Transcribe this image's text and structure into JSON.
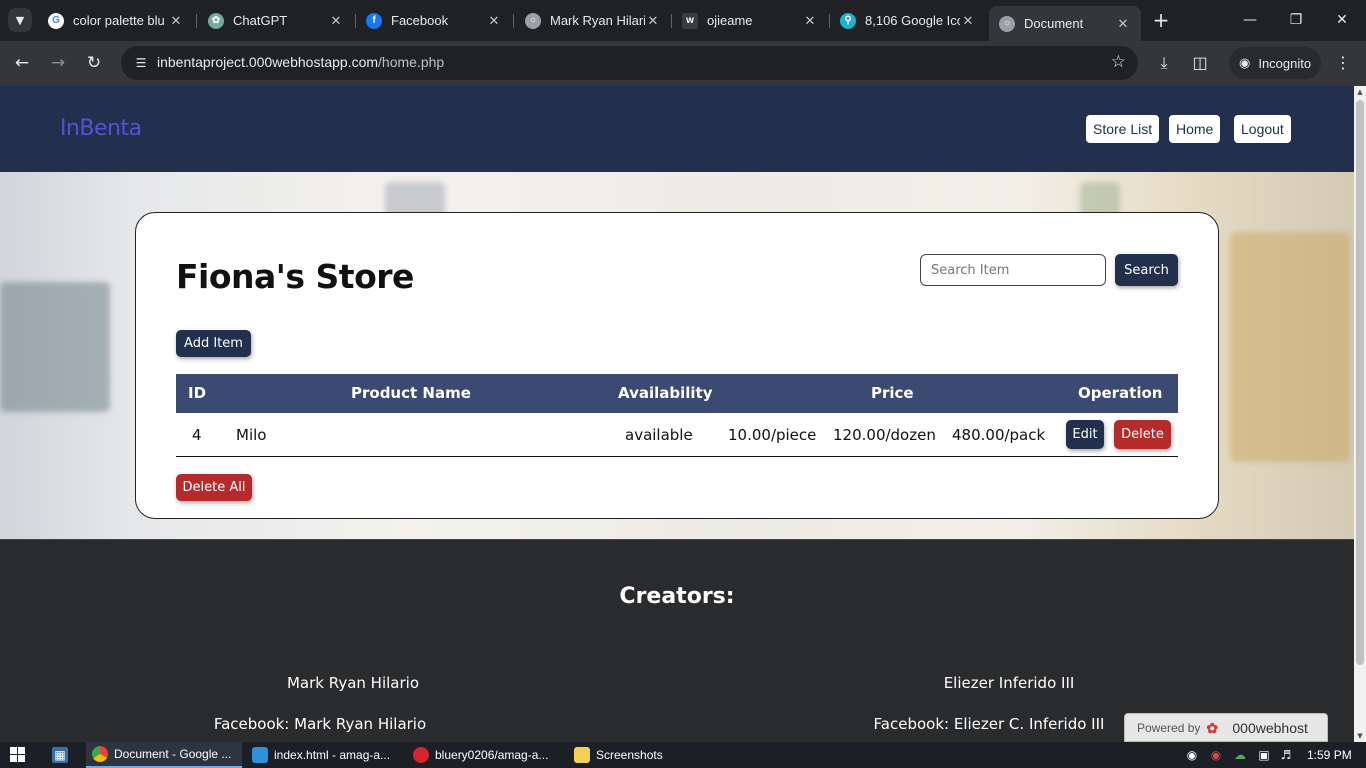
{
  "browser": {
    "tabs": [
      {
        "title": "color palette blu",
        "favicon": "google-icon",
        "color": "#ffffff"
      },
      {
        "title": "ChatGPT",
        "favicon": "chatgpt-icon",
        "color": "#74aa9c"
      },
      {
        "title": "Facebook",
        "favicon": "facebook-icon",
        "color": "#1877f2"
      },
      {
        "title": "Mark Ryan Hilari",
        "favicon": "globe-icon",
        "color": "#9aa0a6"
      },
      {
        "title": "ojieame",
        "favicon": "w-icon",
        "color": "#3a3b3f"
      },
      {
        "title": "8,106 Google Ico",
        "favicon": "search-badge-icon",
        "color": "#1ab3d6"
      },
      {
        "title": "Document",
        "favicon": "globe-icon",
        "color": "#9aa0a6"
      }
    ],
    "url_host": "inbentaproject.000webhostapp.com",
    "url_path": "/home.php",
    "incognito_label": "Incognito"
  },
  "site": {
    "logo": "InBenta",
    "nav": {
      "store_list": "Store List",
      "home": "Home",
      "logout": "Logout"
    }
  },
  "store": {
    "title": "Fiona's Store",
    "search_placeholder": "Search Item",
    "search_button": "Search",
    "add_button": "Add Item",
    "delete_all_button": "Delete All",
    "columns": {
      "id": "ID",
      "name": "Product Name",
      "availability": "Availability",
      "price": "Price",
      "operation": "Operation"
    },
    "rows": [
      {
        "id": "4",
        "name": "Milo",
        "availability": "available",
        "price_piece": "10.00/piece",
        "price_dozen": "120.00/dozen",
        "price_pack": "480.00/pack",
        "edit": "Edit",
        "delete": "Delete"
      }
    ]
  },
  "footer": {
    "title": "Creators:",
    "creators": [
      {
        "name": "Mark Ryan Hilario",
        "facebook": "Facebook: Mark Ryan Hilario"
      },
      {
        "name": "Eliezer Inferido III",
        "facebook": "Facebook: Eliezer C. Inferido III"
      }
    ],
    "powered_label": "Powered by",
    "powered_brand": "000webhost"
  },
  "taskbar": {
    "items": [
      {
        "label": "Document - Google ...",
        "icon": "chrome-icon"
      },
      {
        "label": "index.html - amag-a...",
        "icon": "vscode-icon"
      },
      {
        "label": "bluery0206/amag-a...",
        "icon": "opera-icon"
      },
      {
        "label": "Screenshots",
        "icon": "folder-icon"
      }
    ],
    "time": "1:59 PM"
  }
}
